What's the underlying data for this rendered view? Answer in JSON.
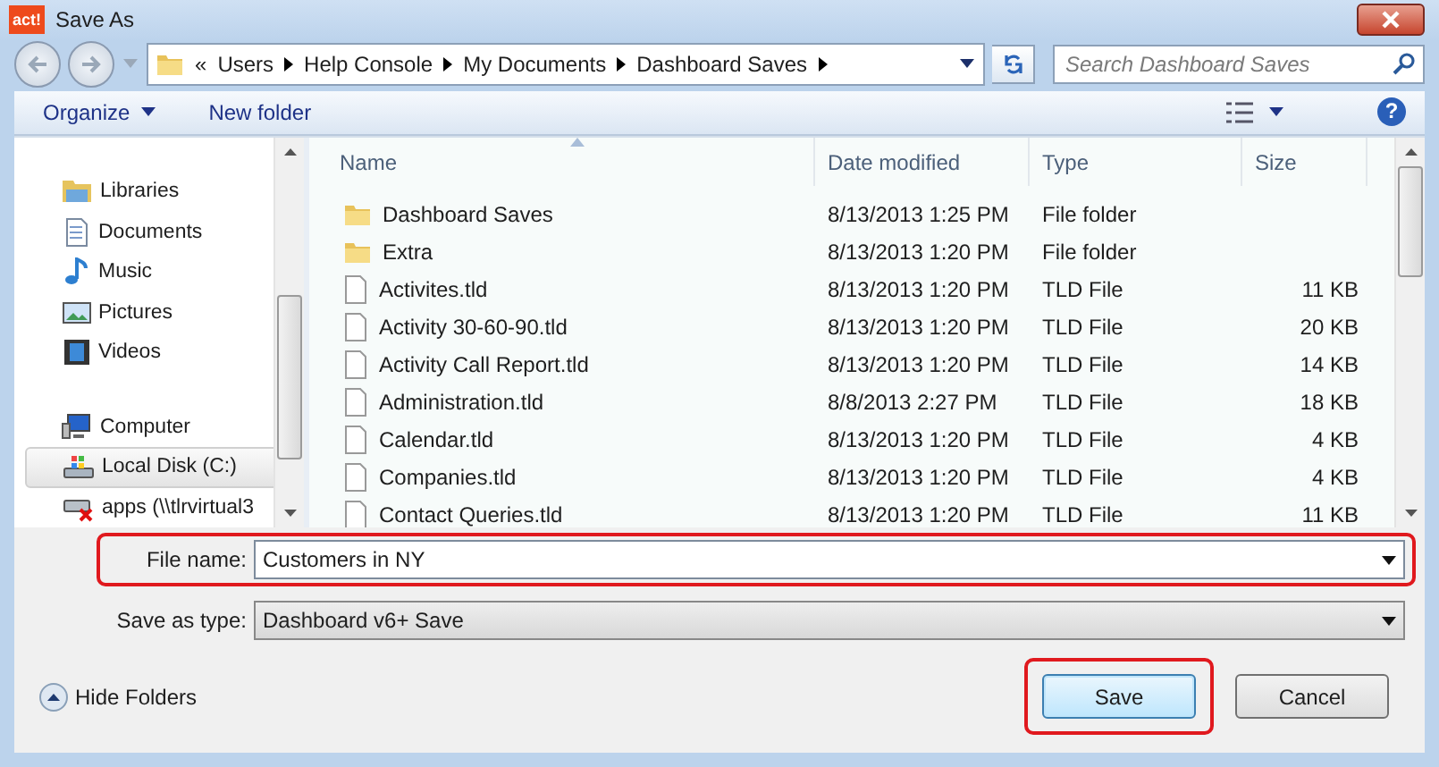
{
  "window": {
    "app_badge": "act!",
    "title": "Save As"
  },
  "address_bar": {
    "overflow": "«",
    "crumbs": [
      "Users",
      "Help Console",
      "My Documents",
      "Dashboard Saves"
    ]
  },
  "search": {
    "placeholder": "Search Dashboard Saves"
  },
  "toolbar": {
    "organize": "Organize",
    "new_folder": "New folder",
    "help": "?"
  },
  "sidebar": {
    "groups": [
      {
        "kind": "library",
        "label": "Libraries",
        "selected": false,
        "children": [
          {
            "kind": "documents",
            "label": "Documents",
            "selected": false
          },
          {
            "kind": "music",
            "label": "Music",
            "selected": false
          },
          {
            "kind": "pictures",
            "label": "Pictures",
            "selected": false
          },
          {
            "kind": "videos",
            "label": "Videos",
            "selected": false
          }
        ]
      },
      {
        "kind": "computer",
        "label": "Computer",
        "selected": false,
        "children": [
          {
            "kind": "disk",
            "label": "Local Disk (C:)",
            "selected": true
          },
          {
            "kind": "network",
            "label": "apps (\\\\tlrvirtual3",
            "selected": false
          }
        ]
      }
    ]
  },
  "file_list": {
    "columns": [
      {
        "label": "Name",
        "sorted": true
      },
      {
        "label": "Date modified",
        "sorted": false
      },
      {
        "label": "Type",
        "sorted": false
      },
      {
        "label": "Size",
        "sorted": false
      }
    ],
    "rows": [
      {
        "kind": "folder",
        "name": "Dashboard Saves",
        "date": "8/13/2013 1:25 PM",
        "type": "File folder"
      },
      {
        "kind": "folder",
        "name": "Extra",
        "date": "8/13/2013 1:20 PM",
        "type": "File folder"
      },
      {
        "kind": "file",
        "name": "Activites.tld",
        "date": "8/13/2013 1:20 PM",
        "type": "TLD File",
        "size": "11 KB"
      },
      {
        "kind": "file",
        "name": "Activity 30-60-90.tld",
        "date": "8/13/2013 1:20 PM",
        "type": "TLD File",
        "size": "20 KB"
      },
      {
        "kind": "file",
        "name": "Activity Call Report.tld",
        "date": "8/13/2013 1:20 PM",
        "type": "TLD File",
        "size": "14 KB"
      },
      {
        "kind": "file",
        "name": "Administration.tld",
        "date": "8/8/2013 2:27 PM",
        "type": "TLD File",
        "size": "18 KB"
      },
      {
        "kind": "file",
        "name": "Calendar.tld",
        "date": "8/13/2013 1:20 PM",
        "type": "TLD File",
        "size": "4 KB"
      },
      {
        "kind": "file",
        "name": "Companies.tld",
        "date": "8/13/2013 1:20 PM",
        "type": "TLD File",
        "size": "4 KB"
      },
      {
        "kind": "file",
        "name": "Contact Queries.tld",
        "date": "8/13/2013 1:20 PM",
        "type": "TLD File",
        "size": "11 KB"
      }
    ]
  },
  "file_name": {
    "label": "File name:",
    "value": "Customers in NY",
    "highlighted": true
  },
  "save_type": {
    "label": "Save as type:",
    "value": "Dashboard v6+ Save"
  },
  "hide_folders": "Hide Folders",
  "buttons": [
    {
      "label": "Save",
      "default": true,
      "highlighted": true
    },
    {
      "label": "Cancel",
      "default": false,
      "highlighted": false
    }
  ]
}
